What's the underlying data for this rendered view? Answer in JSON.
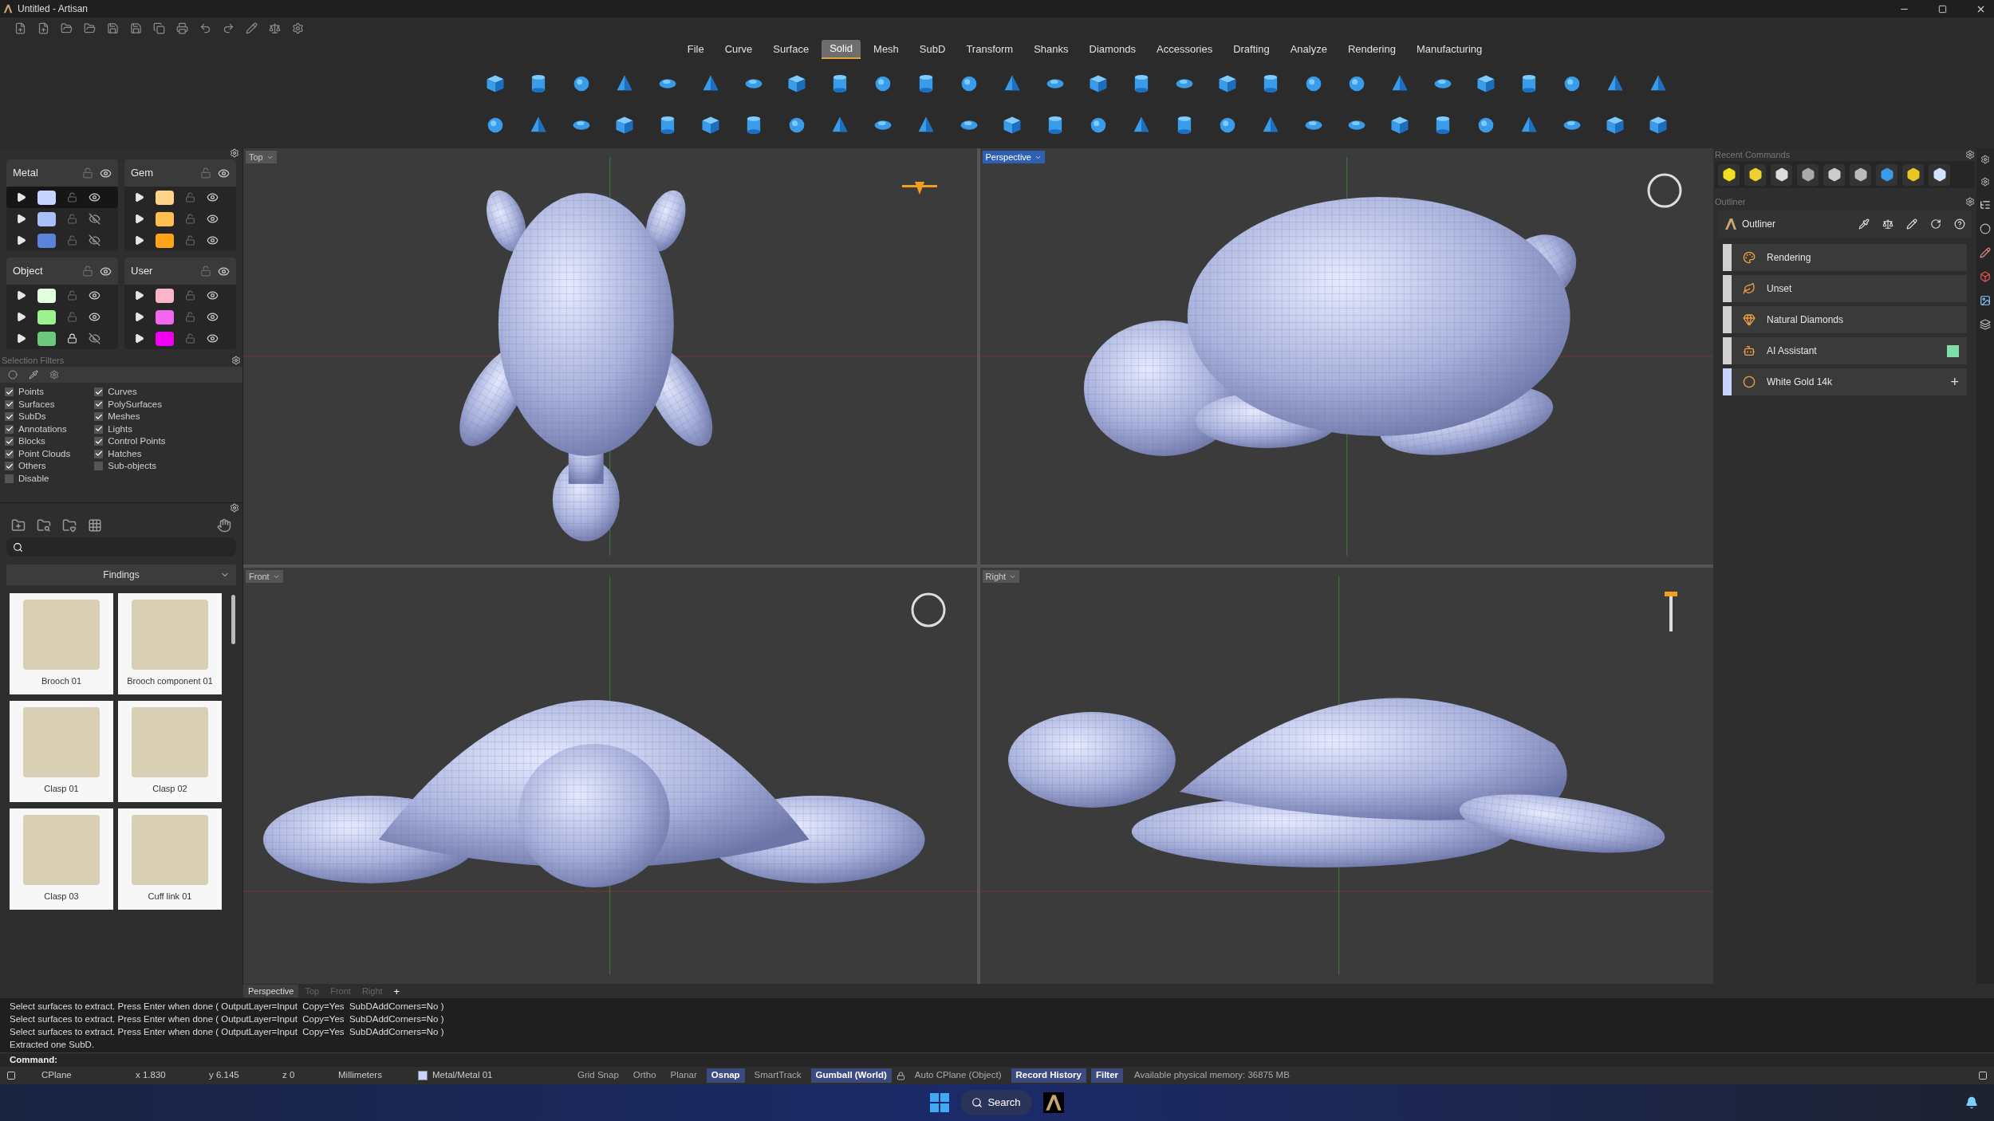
{
  "window": {
    "title": "Untitled - Artisan"
  },
  "menu": [
    {
      "label": "File",
      "selected": false
    },
    {
      "label": "Curve",
      "selected": false
    },
    {
      "label": "Surface",
      "selected": false
    },
    {
      "label": "Solid",
      "selected": true
    },
    {
      "label": "Mesh",
      "selected": false
    },
    {
      "label": "SubD",
      "selected": false
    },
    {
      "label": "Transform",
      "selected": false
    },
    {
      "label": "Shanks",
      "selected": false
    },
    {
      "label": "Diamonds",
      "selected": false
    },
    {
      "label": "Accessories",
      "selected": false
    },
    {
      "label": "Drafting",
      "selected": false
    },
    {
      "label": "Analyze",
      "selected": false
    },
    {
      "label": "Rendering",
      "selected": false
    },
    {
      "label": "Manufacturing",
      "selected": false
    }
  ],
  "layers": [
    {
      "name": "Metal",
      "rows": [
        {
          "color": "#c6d4ff",
          "locked": false,
          "visible": true,
          "selected": true
        },
        {
          "color": "#a8c0f8",
          "locked": false,
          "visible": false,
          "selected": false
        },
        {
          "color": "#5b84d8",
          "locked": false,
          "visible": false,
          "selected": false
        }
      ]
    },
    {
      "name": "Gem",
      "rows": [
        {
          "color": "#ffd38a",
          "locked": false,
          "visible": true,
          "selected": false
        },
        {
          "color": "#ffbe50",
          "locked": false,
          "visible": true,
          "selected": false
        },
        {
          "color": "#ffa418",
          "locked": false,
          "visible": true,
          "selected": false
        }
      ]
    },
    {
      "name": "Object",
      "rows": [
        {
          "color": "#e2ffe0",
          "locked": false,
          "visible": true,
          "selected": false
        },
        {
          "color": "#9cf28c",
          "locked": false,
          "visible": true,
          "selected": false
        },
        {
          "color": "#6cc87a",
          "locked": true,
          "visible": false,
          "selected": false
        }
      ]
    },
    {
      "name": "User",
      "rows": [
        {
          "color": "#f8b6c8",
          "locked": false,
          "visible": true,
          "selected": false
        },
        {
          "color": "#f266f0",
          "locked": false,
          "visible": true,
          "selected": false
        },
        {
          "color": "#f000f0",
          "locked": false,
          "visible": true,
          "selected": false
        }
      ]
    }
  ],
  "selection_filters": {
    "title": "Selection Filters",
    "columns": [
      [
        {
          "label": "Points",
          "checked": true
        },
        {
          "label": "Surfaces",
          "checked": true
        },
        {
          "label": "SubDs",
          "checked": true
        },
        {
          "label": "Annotations",
          "checked": true
        },
        {
          "label": "Blocks",
          "checked": true
        },
        {
          "label": "Point Clouds",
          "checked": true
        },
        {
          "label": "Others",
          "checked": true
        },
        {
          "label": "Disable",
          "checked": false
        }
      ],
      [
        {
          "label": "Curves",
          "checked": true
        },
        {
          "label": "PolySurfaces",
          "checked": true
        },
        {
          "label": "Meshes",
          "checked": true
        },
        {
          "label": "Lights",
          "checked": true
        },
        {
          "label": "Control Points",
          "checked": true
        },
        {
          "label": "Hatches",
          "checked": true
        },
        {
          "label": "Sub-objects",
          "checked": false
        }
      ]
    ]
  },
  "library": {
    "category": "Findings",
    "items": [
      {
        "name": "Brooch 01"
      },
      {
        "name": "Brooch component 01"
      },
      {
        "name": "Clasp 01"
      },
      {
        "name": "Clasp 02"
      },
      {
        "name": "Clasp 03"
      },
      {
        "name": "Cuff link 01"
      }
    ]
  },
  "viewports": [
    {
      "label": "Top",
      "selected": false
    },
    {
      "label": "Perspective",
      "selected": true
    },
    {
      "label": "Front",
      "selected": false
    },
    {
      "label": "Right",
      "selected": false
    }
  ],
  "view_tabs": [
    {
      "label": "Perspective",
      "selected": true
    },
    {
      "label": "Top",
      "selected": false
    },
    {
      "label": "Front",
      "selected": false
    },
    {
      "label": "Right",
      "selected": false
    }
  ],
  "add_tab": "+",
  "command_history": [
    "Select surfaces to extract. Press Enter when done ( OutputLayer=Input  Copy=Yes  SubDAddCorners=No )",
    "Select surfaces to extract. Press Enter when done ( OutputLayer=Input  Copy=Yes  SubDAddCorners=No )",
    "Select surfaces to extract. Press Enter when done ( OutputLayer=Input  Copy=Yes  SubDAddCorners=No )",
    "Extracted one SubD."
  ],
  "command_prompt": "Command:",
  "status_bar": {
    "cplane": "CPlane",
    "x": "x 1.830",
    "y": "y 6.145",
    "z": "z 0",
    "units": "Millimeters",
    "layer": {
      "name": "Metal/Metal 01",
      "color": "#c6d4ff"
    },
    "toggles": [
      {
        "label": "Grid Snap",
        "on": false
      },
      {
        "label": "Ortho",
        "on": false
      },
      {
        "label": "Planar",
        "on": false
      },
      {
        "label": "Osnap",
        "on": true
      },
      {
        "label": "SmartTrack",
        "on": false
      },
      {
        "label": "Gumball (World)",
        "on": true
      },
      {
        "label": "Auto CPlane (Object)",
        "on": false
      },
      {
        "label": "Record History",
        "on": true
      },
      {
        "label": "Filter",
        "on": true
      }
    ],
    "memory": "Available physical memory: 36875 MB"
  },
  "recent_commands": {
    "title": "Recent Commands"
  },
  "outliner": {
    "title": "Outliner",
    "header": "Outliner",
    "items": [
      {
        "label": "Rendering",
        "color": "#d0d0d0"
      },
      {
        "label": "Unset",
        "color": "#d0d0d0"
      },
      {
        "label": "Natural Diamonds",
        "color": "#d0d0d0"
      },
      {
        "label": "AI Assistant",
        "color": "#d0d0d0",
        "swatch": {
          "color": "#7ee0a8"
        }
      },
      {
        "label": "White Gold 14k",
        "color": "#c8d4ff",
        "action": "+"
      }
    ]
  },
  "taskbar": {
    "search": "Search"
  }
}
